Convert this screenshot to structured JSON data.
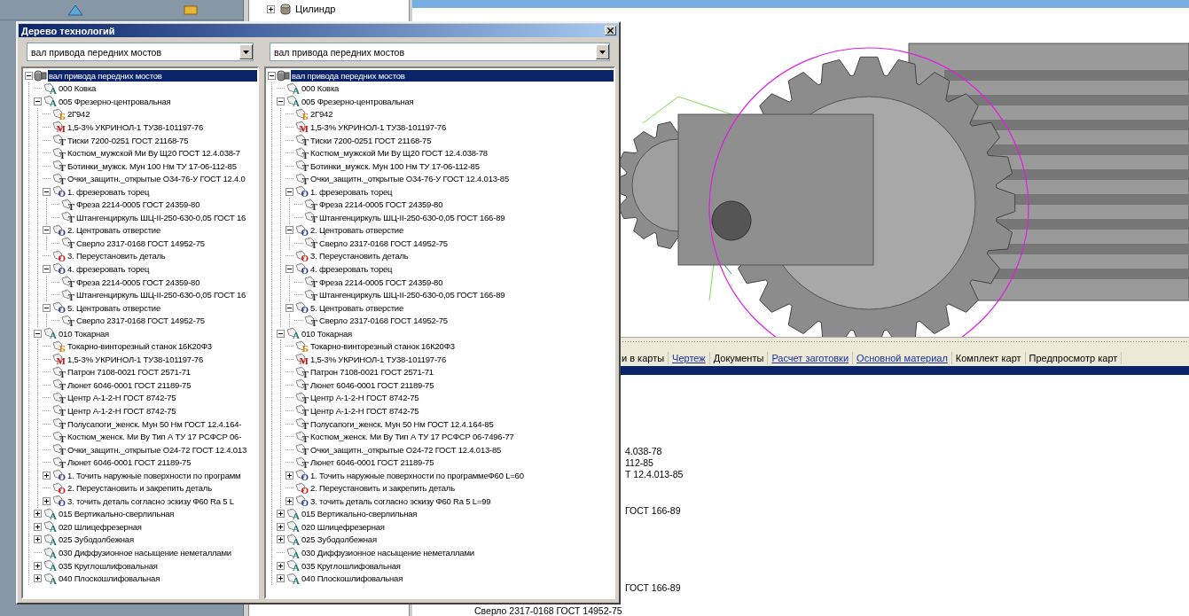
{
  "app": {
    "side_tree": [
      {
        "label": "Цилиндр",
        "expanded": false
      }
    ],
    "tabs": [
      {
        "label": "и в карты",
        "kind": "plain"
      },
      {
        "label": "Чертеж",
        "kind": "link"
      },
      {
        "label": "Документы",
        "kind": "plain"
      },
      {
        "label": "Расчет заготовки",
        "kind": "link"
      },
      {
        "label": "Основной материал",
        "kind": "link"
      },
      {
        "label": "Комплект карт",
        "kind": "plain"
      },
      {
        "label": "Предпросмотр карт",
        "kind": "plain"
      }
    ],
    "background_lines": [
      "4.038-78",
      "112-85",
      "Т 12.4.013-85",
      "ГОСТ 166-89",
      "ГОСТ 166-89",
      "Сверло 2317-0168 ГОСТ 14952-75"
    ]
  },
  "dialog": {
    "title": "Дерево технологий",
    "panes": [
      {
        "selector": "вал привода передних мостов",
        "tree": {
          "label": "вал привода передних мостов",
          "kind": "part",
          "expanded": true,
          "selected": true,
          "children": [
            {
              "label": "000 Ковка",
              "kind": "operation",
              "badge": "А",
              "selected": false
            },
            {
              "label": "005 Фрезерно-центровальная",
              "kind": "operation",
              "badge": "А",
              "expanded": true,
              "selected": false,
              "children": [
                {
                  "label": "2Г942",
                  "kind": "equipment",
                  "badge": "Б",
                  "selected": false
                },
                {
                  "label": "1,5-3% УКРИНОЛ-1 ТУ38-101197-76",
                  "kind": "material",
                  "badge": "М",
                  "selected": false
                },
                {
                  "label": "Тиски 7200-0251 ГОСТ 21168-75",
                  "kind": "tool",
                  "badge": "Т",
                  "selected": false
                },
                {
                  "label": "Костюм_мужской Ми Ву Щ20 ГОСТ 12.4.038-7",
                  "kind": "tool",
                  "badge": "Т",
                  "selected": false
                },
                {
                  "label": "Ботинки_мужск. Мун 100 Нм ТУ 17-06-112-85",
                  "kind": "tool",
                  "badge": "Т",
                  "selected": false
                },
                {
                  "label": "Очки_защитн._открытые О34-76-У ГОСТ 12.4.0",
                  "kind": "tool",
                  "badge": "Т",
                  "selected": false
                },
                {
                  "label": "1. фрезеровать торец",
                  "kind": "step",
                  "badge": "О",
                  "expanded": true,
                  "selected": false,
                  "children": [
                    {
                      "label": "Фреза 2214-0005 ГОСТ 24359-80",
                      "kind": "tool",
                      "badge": "Т",
                      "selected": false
                    },
                    {
                      "label": "Штангенциркуль ШЦ-II-250-630-0,05 ГОСТ 16",
                      "kind": "tool",
                      "badge": "Т",
                      "selected": false
                    }
                  ]
                },
                {
                  "label": "2. Центровать отверстие",
                  "kind": "step",
                  "badge": "О",
                  "expanded": true,
                  "selected": false,
                  "children": [
                    {
                      "label": "Сверло 2317-0168 ГОСТ 14952-75",
                      "kind": "tool",
                      "badge": "Т",
                      "selected": false
                    }
                  ]
                },
                {
                  "label": "3. Переустановить деталь",
                  "kind": "setup",
                  "badge": "О",
                  "selected": false
                },
                {
                  "label": "4. фрезеровать торец",
                  "kind": "step",
                  "badge": "О",
                  "expanded": true,
                  "selected": false,
                  "children": [
                    {
                      "label": "Фреза 2214-0005 ГОСТ 24359-80",
                      "kind": "tool",
                      "badge": "Т",
                      "selected": false
                    },
                    {
                      "label": "Штангенциркуль ШЦ-II-250-630-0,05 ГОСТ 16",
                      "kind": "tool",
                      "badge": "Т",
                      "selected": false
                    }
                  ]
                },
                {
                  "label": "5. Центровать отверстие",
                  "kind": "step",
                  "badge": "О",
                  "expanded": true,
                  "selected": false,
                  "children": [
                    {
                      "label": "Сверло 2317-0168 ГОСТ 14952-75",
                      "kind": "tool",
                      "badge": "Т",
                      "selected": false
                    }
                  ]
                }
              ]
            },
            {
              "label": "010 Токарная",
              "kind": "operation",
              "badge": "А",
              "expanded": true,
              "selected": false,
              "children": [
                {
                  "label": "Токарно-винторезный станок 16К20Ф3",
                  "kind": "equipment",
                  "badge": "Б",
                  "selected": false
                },
                {
                  "label": "1,5-3% УКРИНОЛ-1 ТУ38-101197-76",
                  "kind": "material",
                  "badge": "М",
                  "selected": false
                },
                {
                  "label": "Патрон 7108-0021 ГОСТ 2571-71",
                  "kind": "tool",
                  "badge": "Т",
                  "selected": false
                },
                {
                  "label": "Люнет 6046-0001 ГОСТ 21189-75",
                  "kind": "tool",
                  "badge": "Т",
                  "selected": false
                },
                {
                  "label": "Центр А-1-2-Н ГОСТ 8742-75",
                  "kind": "tool",
                  "badge": "Т",
                  "selected": false
                },
                {
                  "label": "Центр А-1-2-Н ГОСТ 8742-75",
                  "kind": "tool",
                  "badge": "Т",
                  "selected": false
                },
                {
                  "label": "Полусапоги_женск. Мун 50 Нм ГОСТ 12.4.164-",
                  "kind": "tool",
                  "badge": "Т",
                  "selected": false
                },
                {
                  "label": "Костюм_женск. Ми Ву Тип А ТУ 17 РСФСР 06-",
                  "kind": "tool",
                  "badge": "Т",
                  "selected": false
                },
                {
                  "label": "Очки_защитн._открытые О24-72 ГОСТ 12.4.013",
                  "kind": "tool",
                  "badge": "Т",
                  "selected": false
                },
                {
                  "label": "Люнет 6046-0001 ГОСТ 21189-75",
                  "kind": "tool",
                  "badge": "Т",
                  "selected": false
                },
                {
                  "label": "1. Точить наружные поверхности по программ",
                  "kind": "step",
                  "badge": "О",
                  "expanded": false,
                  "selected": false
                },
                {
                  "label": "2. Переустановить и закрепить деталь",
                  "kind": "setup",
                  "badge": "О",
                  "selected": false
                },
                {
                  "label": "3. точить деталь согласно эскизу Ф60 Ra 5 L",
                  "kind": "step",
                  "badge": "О",
                  "expanded": false,
                  "selected": false
                }
              ]
            },
            {
              "label": "015 Вертикально-сверлильная",
              "kind": "operation",
              "badge": "А",
              "expanded": false,
              "selected": false
            },
            {
              "label": "020 Шлицефрезерная",
              "kind": "operation",
              "badge": "А",
              "expanded": false,
              "selected": false
            },
            {
              "label": "025 Зубодолбежная",
              "kind": "operation",
              "badge": "А",
              "expanded": false,
              "selected": false
            },
            {
              "label": "030 Диффузионное насыщение неметаллами",
              "kind": "operation",
              "badge": "А",
              "selected": false
            },
            {
              "label": "035 Круглошлифовальная",
              "kind": "operation",
              "badge": "А",
              "expanded": false,
              "selected": false
            },
            {
              "label": "040 Плоскошлифовальная",
              "kind": "operation",
              "badge": "А",
              "expanded": false,
              "selected": false
            }
          ]
        }
      },
      {
        "selector": "вал привода передних мостов",
        "tree": {
          "label": "вал привода передних мостов",
          "kind": "part",
          "expanded": true,
          "selected": true,
          "children": [
            {
              "label": "000 Ковка",
              "kind": "operation",
              "badge": "А",
              "selected": false
            },
            {
              "label": "005 Фрезерно-центровальная",
              "kind": "operation",
              "badge": "А",
              "expanded": true,
              "selected": false,
              "children": [
                {
                  "label": "2Г942",
                  "kind": "equipment",
                  "badge": "Б",
                  "selected": false
                },
                {
                  "label": "1,5-3% УКРИНОЛ-1 ТУ38-101197-76",
                  "kind": "material",
                  "badge": "М",
                  "selected": false
                },
                {
                  "label": "Тиски 7200-0251 ГОСТ 21168-75",
                  "kind": "tool",
                  "badge": "Т",
                  "selected": false
                },
                {
                  "label": "Костюм_мужской Ми Ву Щ20 ГОСТ 12.4.038-78",
                  "kind": "tool",
                  "badge": "Т",
                  "selected": false
                },
                {
                  "label": "Ботинки_мужск. Мун 100 Нм ТУ 17-06-112-85",
                  "kind": "tool",
                  "badge": "Т",
                  "selected": false
                },
                {
                  "label": "Очки_защитн._открытые О34-76-У ГОСТ 12.4.013-85",
                  "kind": "tool",
                  "badge": "Т",
                  "selected": false
                },
                {
                  "label": "1. фрезеровать торец",
                  "kind": "step",
                  "badge": "О",
                  "expanded": true,
                  "selected": false,
                  "children": [
                    {
                      "label": "Фреза 2214-0005 ГОСТ 24359-80",
                      "kind": "tool",
                      "badge": "Т",
                      "selected": false
                    },
                    {
                      "label": "Штангенциркуль ШЦ-II-250-630-0,05 ГОСТ 166-89",
                      "kind": "tool",
                      "badge": "Т",
                      "selected": false
                    }
                  ]
                },
                {
                  "label": "2. Центровать отверстие",
                  "kind": "step",
                  "badge": "О",
                  "expanded": true,
                  "selected": false,
                  "children": [
                    {
                      "label": "Сверло 2317-0168 ГОСТ 14952-75",
                      "kind": "tool",
                      "badge": "Т",
                      "selected": false
                    }
                  ]
                },
                {
                  "label": "3. Переустановить деталь",
                  "kind": "setup",
                  "badge": "О",
                  "selected": false
                },
                {
                  "label": "4. фрезеровать торец",
                  "kind": "step",
                  "badge": "О",
                  "expanded": true,
                  "selected": false,
                  "children": [
                    {
                      "label": "Фреза 2214-0005 ГОСТ 24359-80",
                      "kind": "tool",
                      "badge": "Т",
                      "selected": false
                    },
                    {
                      "label": "Штангенциркуль ШЦ-II-250-630-0,05 ГОСТ 166-89",
                      "kind": "tool",
                      "badge": "Т",
                      "selected": false
                    }
                  ]
                },
                {
                  "label": "5. Центровать отверстие",
                  "kind": "step",
                  "badge": "О",
                  "expanded": true,
                  "selected": false,
                  "children": [
                    {
                      "label": "Сверло 2317-0168 ГОСТ 14952-75",
                      "kind": "tool",
                      "badge": "Т",
                      "selected": false
                    }
                  ]
                }
              ]
            },
            {
              "label": "010 Токарная",
              "kind": "operation",
              "badge": "А",
              "expanded": true,
              "selected": false,
              "children": [
                {
                  "label": "Токарно-винторезный станок 16К20Ф3",
                  "kind": "equipment",
                  "badge": "Б",
                  "selected": false
                },
                {
                  "label": "1,5-3% УКРИНОЛ-1 ТУ38-101197-76",
                  "kind": "material",
                  "badge": "М",
                  "selected": false
                },
                {
                  "label": "Патрон 7108-0021 ГОСТ 2571-71",
                  "kind": "tool",
                  "badge": "Т",
                  "selected": false
                },
                {
                  "label": "Люнет 6046-0001 ГОСТ 21189-75",
                  "kind": "tool",
                  "badge": "Т",
                  "selected": false
                },
                {
                  "label": "Центр А-1-2-Н ГОСТ 8742-75",
                  "kind": "tool",
                  "badge": "Т",
                  "selected": false
                },
                {
                  "label": "Центр А-1-2-Н ГОСТ 8742-75",
                  "kind": "tool",
                  "badge": "Т",
                  "selected": false
                },
                {
                  "label": "Полусапоги_женск. Мун 50 Нм ГОСТ 12.4.164-85",
                  "kind": "tool",
                  "badge": "Т",
                  "selected": false
                },
                {
                  "label": "Костюм_женск. Ми Ву Тип А ТУ 17 РСФСР 06-7496-77",
                  "kind": "tool",
                  "badge": "Т",
                  "selected": false
                },
                {
                  "label": "Очки_защитн._открытые О24-72 ГОСТ 12.4.013-85",
                  "kind": "tool",
                  "badge": "Т",
                  "selected": false
                },
                {
                  "label": "Люнет 6046-0001 ГОСТ 21189-75",
                  "kind": "tool",
                  "badge": "Т",
                  "selected": false
                },
                {
                  "label": "1. Точить наружные поверхности по программеФ60 L=60",
                  "kind": "step",
                  "badge": "О",
                  "expanded": false,
                  "selected": false
                },
                {
                  "label": "2. Переустановить и закрепить деталь",
                  "kind": "setup",
                  "badge": "О",
                  "selected": false
                },
                {
                  "label": "3. точить деталь согласно эскизу Ф60 Ra 5 L=99",
                  "kind": "step",
                  "badge": "О",
                  "expanded": false,
                  "selected": false
                }
              ]
            },
            {
              "label": "015 Вертикально-сверлильная",
              "kind": "operation",
              "badge": "А",
              "expanded": false,
              "selected": false
            },
            {
              "label": "020 Шлицефрезерная",
              "kind": "operation",
              "badge": "А",
              "expanded": false,
              "selected": false
            },
            {
              "label": "025 Зубодолбежная",
              "kind": "operation",
              "badge": "А",
              "expanded": false,
              "selected": false
            },
            {
              "label": "030 Диффузионное насыщение неметаллами",
              "kind": "operation",
              "badge": "А",
              "selected": false
            },
            {
              "label": "035 Круглошлифовальная",
              "kind": "operation",
              "badge": "А",
              "expanded": false,
              "selected": false
            },
            {
              "label": "040 Плоскошлифовальная",
              "kind": "operation",
              "badge": "А",
              "expanded": false,
              "selected": false
            }
          ]
        }
      }
    ]
  }
}
